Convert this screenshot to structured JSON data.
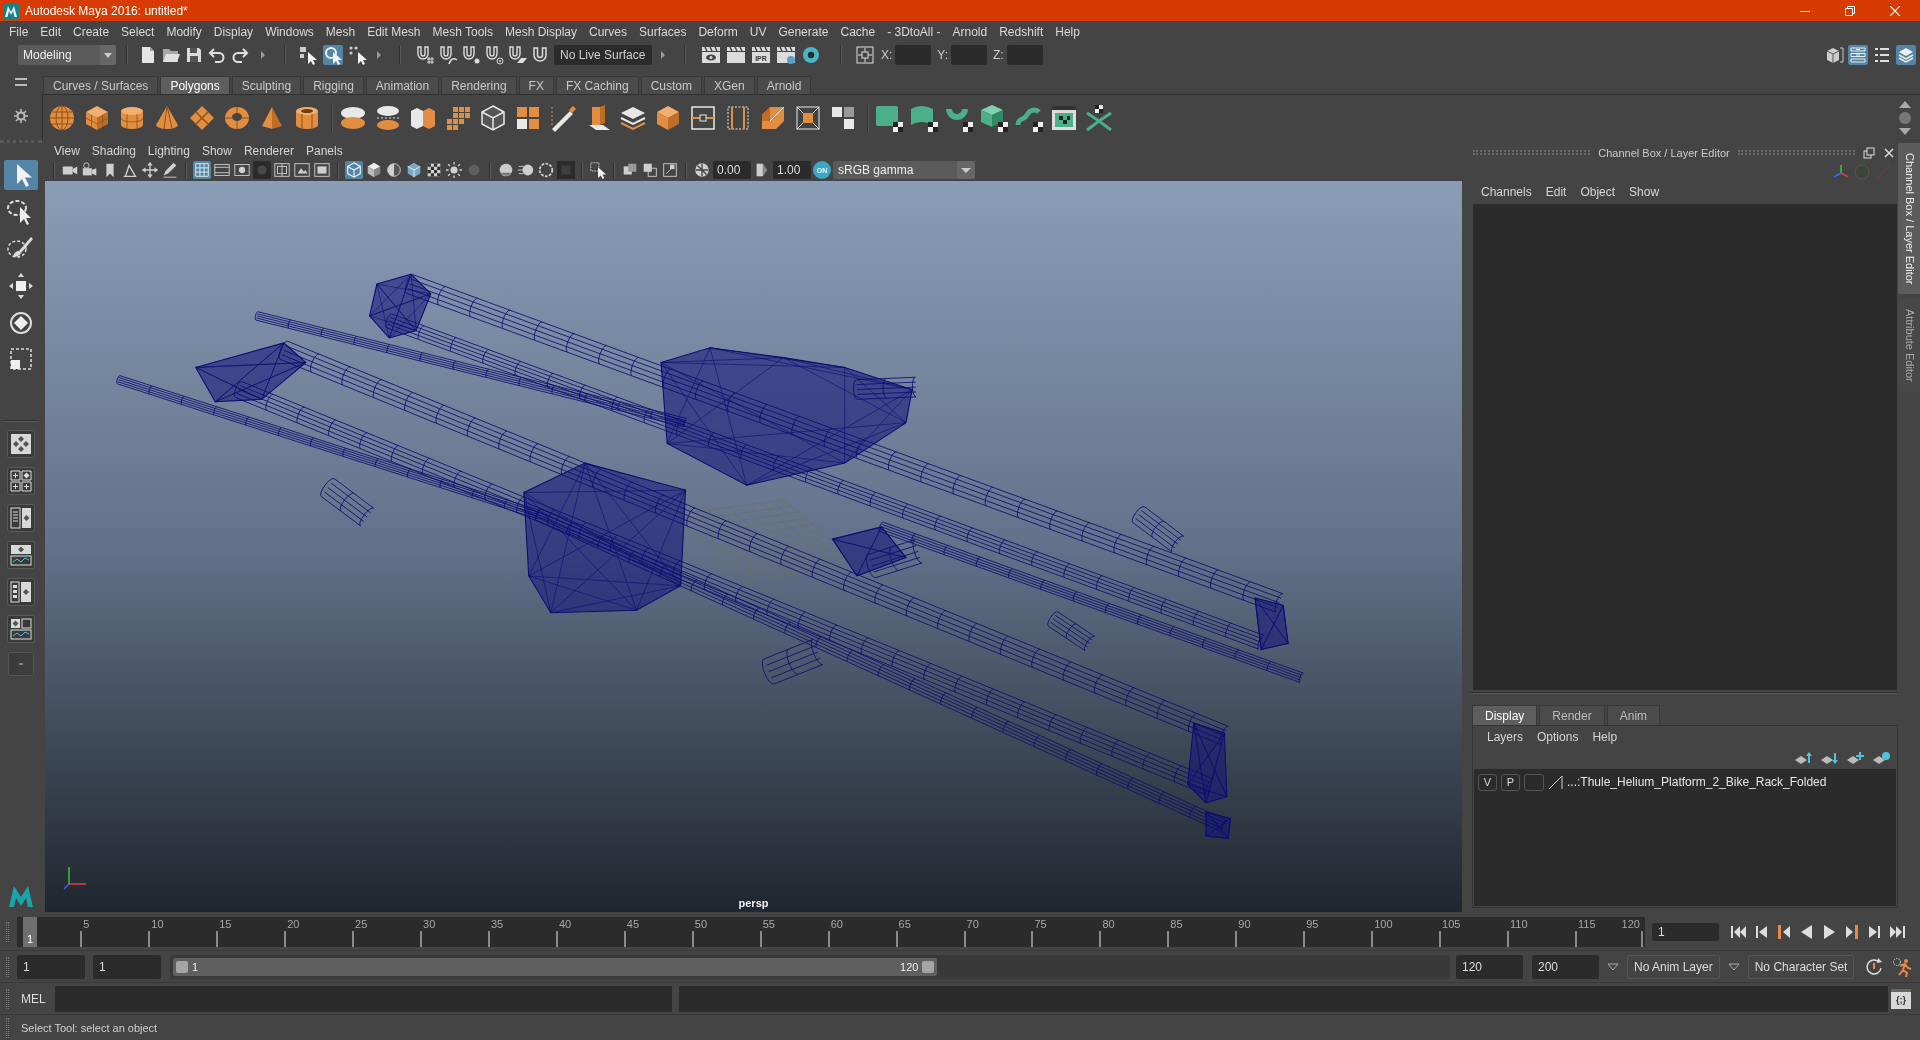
{
  "window": {
    "title": "Autodesk Maya 2016: untitled*"
  },
  "menu_bar": [
    "File",
    "Edit",
    "Create",
    "Select",
    "Modify",
    "Display",
    "Windows",
    "Mesh",
    "Edit Mesh",
    "Mesh Tools",
    "Mesh Display",
    "Curves",
    "Surfaces",
    "Deform",
    "UV",
    "Generate",
    "Cache",
    "- 3DtoAll -",
    "Arnold",
    "Redshift",
    "Help"
  ],
  "status_line": {
    "menu_set": "Modeling",
    "selection_modes": [
      {
        "selected": false
      },
      {
        "selected": true
      },
      {
        "selected": false
      }
    ],
    "live_surface": "No Live Surface",
    "ipr_label": "IPR",
    "coordinates": [
      {
        "label": "X:"
      },
      {
        "label": "Y:"
      },
      {
        "label": "Z:"
      }
    ],
    "panel_toggles": [
      {
        "selected": false
      },
      {
        "selected": true
      },
      {
        "selected": false
      },
      {
        "selected": true
      }
    ]
  },
  "shelf": {
    "tabs": [
      {
        "label": "Curves / Surfaces",
        "selected": false
      },
      {
        "label": "Polygons",
        "selected": true
      },
      {
        "label": "Sculpting",
        "selected": false
      },
      {
        "label": "Rigging",
        "selected": false
      },
      {
        "label": "Animation",
        "selected": false
      },
      {
        "label": "Rendering",
        "selected": false
      },
      {
        "label": "FX",
        "selected": false
      },
      {
        "label": "FX Caching",
        "selected": false
      },
      {
        "label": "Custom",
        "selected": false
      },
      {
        "label": "XGen",
        "selected": false
      },
      {
        "label": "Arnold",
        "selected": false
      }
    ]
  },
  "toolbox": {
    "tools": [
      {
        "selected": true
      },
      {
        "selected": false
      },
      {
        "selected": false
      },
      {
        "selected": false
      },
      {
        "selected": false
      },
      {
        "selected": false
      }
    ]
  },
  "viewport": {
    "menu": [
      "View",
      "Shading",
      "Lighting",
      "Show",
      "Renderer",
      "Panels"
    ],
    "view_toggles": [
      {
        "selected": true
      },
      {
        "selected": false
      },
      {
        "selected": false
      },
      {
        "selected": false
      },
      {
        "selected": false
      },
      {
        "selected": false
      },
      {
        "selected": false
      }
    ],
    "shading_toggles": [
      {
        "selected": true
      },
      {
        "selected": false
      },
      {
        "selected": false
      },
      {
        "selected": false
      },
      {
        "selected": false
      },
      {
        "selected": false
      },
      {
        "selected": false
      }
    ],
    "exposure": "0.00",
    "gamma": "1.00",
    "color_management": {
      "on": true,
      "label": "ON"
    },
    "color_space": "sRGB gamma",
    "camera": "persp"
  },
  "channel_box": {
    "title": "Channel Box / Layer Editor",
    "menu": [
      "Channels",
      "Edit",
      "Object",
      "Show"
    ]
  },
  "layer_editor": {
    "tabs": [
      {
        "label": "Display",
        "selected": true
      },
      {
        "label": "Render",
        "selected": false
      },
      {
        "label": "Anim",
        "selected": false
      }
    ],
    "menu": [
      "Layers",
      "Options",
      "Help"
    ],
    "layers": [
      {
        "visibility": "V",
        "playback": "P",
        "name": "...:Thule_Helium_Platform_2_Bike_Rack_Folded"
      }
    ]
  },
  "side_tabs": [
    {
      "label": "Channel Box / Layer Editor",
      "selected": true
    },
    {
      "label": "Attribute Editor",
      "selected": false
    }
  ],
  "time_slider": {
    "current_frame": "1",
    "level": 0,
    "ticks": [
      "5",
      "10",
      "15",
      "20",
      "25",
      "30",
      "35",
      "40",
      "45",
      "50",
      "55",
      "60",
      "65",
      "70",
      "75",
      "80",
      "85",
      "90",
      "95",
      "100",
      "105",
      "110",
      "115",
      "120"
    ],
    "frame_field": "1"
  },
  "range_slider": {
    "start_field": "1",
    "playback_start_field": "1",
    "range_start": "1",
    "range_end": "120",
    "level": 0.6,
    "playback_end_field": "120",
    "end_field": "200",
    "anim_layer": "No Anim Layer",
    "character_set": "No Character Set"
  },
  "command_line": {
    "language": "MEL",
    "script_editor_label": "{;}"
  },
  "help_line": "Select Tool: select an object"
}
